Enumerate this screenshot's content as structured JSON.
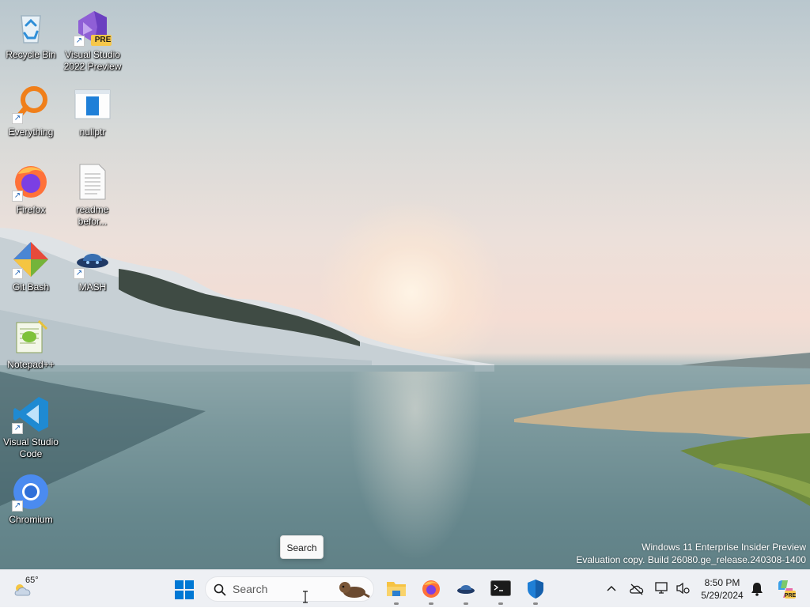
{
  "desktop_icons": [
    {
      "name": "recycle-bin",
      "label": "Recycle Bin"
    },
    {
      "name": "visual-studio-2022-preview",
      "label": "Visual Studio 2022 Preview",
      "badge": "PRE"
    },
    {
      "name": "everything",
      "label": "Everything"
    },
    {
      "name": "nullptr",
      "label": "nullptr"
    },
    {
      "name": "firefox",
      "label": "Firefox"
    },
    {
      "name": "readme",
      "label": "readme befor..."
    },
    {
      "name": "git-bash",
      "label": "Git Bash"
    },
    {
      "name": "mash",
      "label": "MASH"
    },
    {
      "name": "notepad-plus-plus",
      "label": "Notepad++"
    },
    {
      "name": "visual-studio-code",
      "label": "Visual Studio Code"
    },
    {
      "name": "chromium",
      "label": "Chromium"
    }
  ],
  "watermark": {
    "line1": "Windows 11 Enterprise Insider Preview",
    "line2": "Evaluation copy. Build 26080.ge_release.240308-1400"
  },
  "tooltip": {
    "text": "Search"
  },
  "taskbar": {
    "weather": {
      "temp": "65°",
      "icon": "partly-cloudy-icon"
    },
    "search": {
      "placeholder": "Search"
    },
    "apps": [
      "file-explorer",
      "firefox",
      "mash",
      "terminal",
      "windows-security"
    ],
    "tray_icons": [
      "chevron-up-icon",
      "onedrive-offline-icon",
      "network-icon",
      "sound-icon",
      "notification-bell-icon",
      "copilot-icon"
    ],
    "clock": {
      "time": "8:50 PM",
      "date": "5/29/2024"
    }
  },
  "colors": {
    "taskbar_bg": "#eef0f4",
    "accent": "#0067c0"
  }
}
